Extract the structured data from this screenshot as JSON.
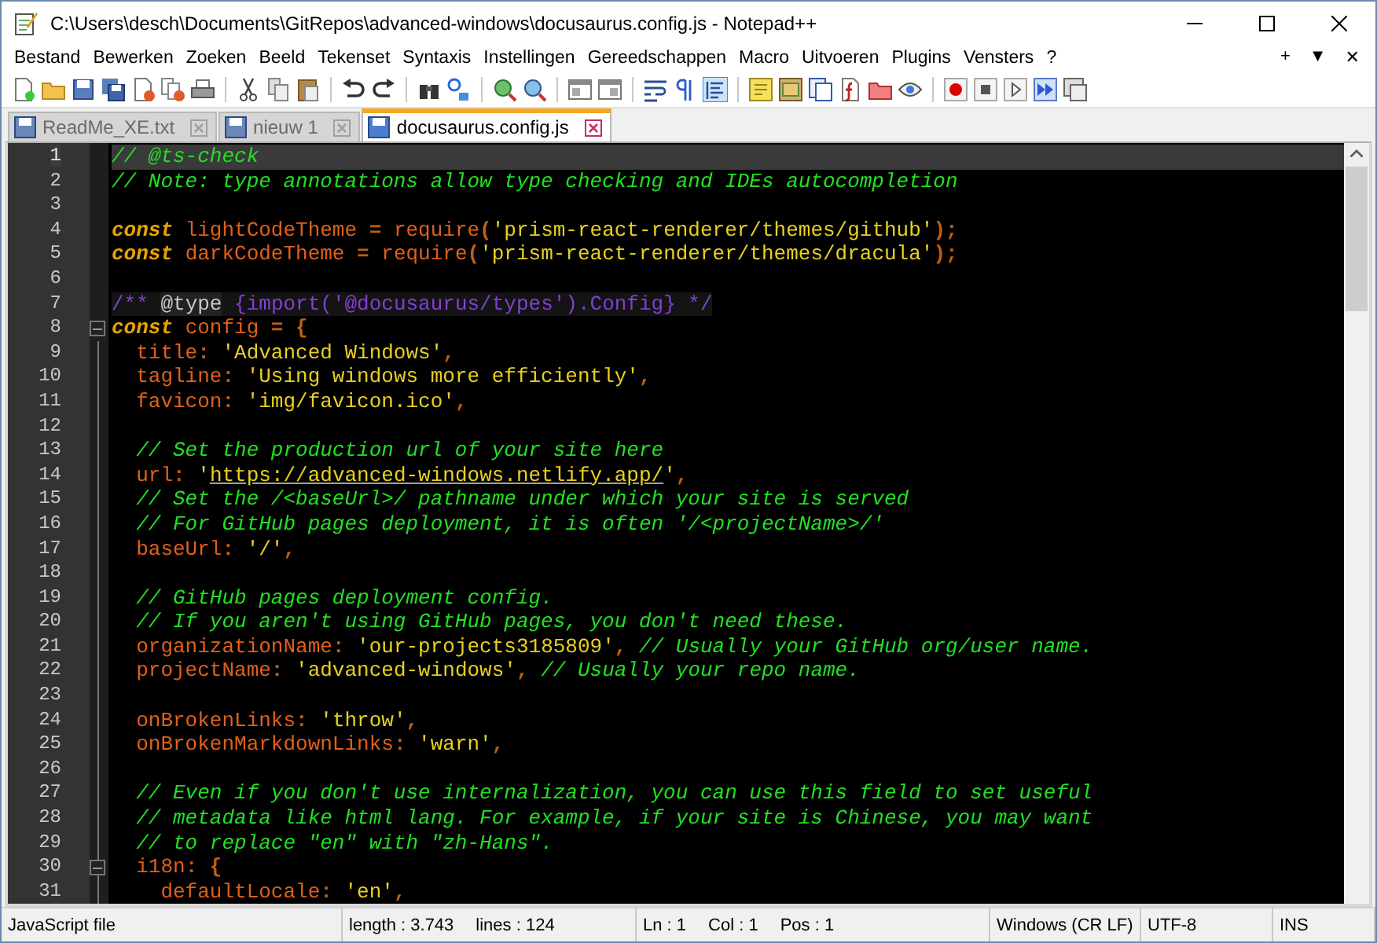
{
  "window": {
    "title": "C:\\Users\\desch\\Documents\\GitRepos\\advanced-windows\\docusaurus.config.js - Notepad++"
  },
  "menu": [
    "Bestand",
    "Bewerken",
    "Zoeken",
    "Beeld",
    "Tekenset",
    "Syntaxis",
    "Instellingen",
    "Gereedschappen",
    "Macro",
    "Uitvoeren",
    "Plugins",
    "Vensters",
    "?"
  ],
  "menu_right": [
    "+",
    "▼",
    "✕"
  ],
  "tabs": [
    {
      "label": "ReadMe_XE.txt",
      "selected": false
    },
    {
      "label": "nieuw 1",
      "selected": false
    },
    {
      "label": "docusaurus.config.js",
      "selected": true
    }
  ],
  "lines": [
    {
      "number": "1",
      "current": true,
      "fold": false,
      "tokens": [
        {
          "kind": "comment",
          "text": "// @ts-check"
        }
      ]
    },
    {
      "number": "2",
      "current": false,
      "fold": false,
      "tokens": [
        {
          "kind": "comment",
          "text": "// Note: type annotations allow type checking and IDEs autocompletion"
        }
      ]
    },
    {
      "number": "3",
      "current": false,
      "fold": false
    },
    {
      "number": "4",
      "current": false,
      "fold": false,
      "tokens": [
        {
          "kind": "keyword",
          "text": "const "
        },
        {
          "kind": "ident",
          "text": "lightCodeTheme"
        },
        {
          "kind": "op",
          "text": " = "
        },
        {
          "kind": "ident",
          "text": "require"
        },
        {
          "kind": "op",
          "text": "("
        },
        {
          "kind": "string",
          "text": "'prism-react-renderer/themes/github'"
        },
        {
          "kind": "op",
          "text": ");"
        }
      ]
    },
    {
      "number": "5",
      "current": false,
      "fold": false,
      "tokens": [
        {
          "kind": "keyword",
          "text": "const "
        },
        {
          "kind": "ident",
          "text": "darkCodeTheme"
        },
        {
          "kind": "op",
          "text": " = "
        },
        {
          "kind": "ident",
          "text": "require"
        },
        {
          "kind": "op",
          "text": "("
        },
        {
          "kind": "string",
          "text": "'prism-react-renderer/themes/dracula'"
        },
        {
          "kind": "op",
          "text": ");"
        }
      ]
    },
    {
      "number": "6",
      "current": false,
      "fold": false
    },
    {
      "number": "7",
      "current": false,
      "fold": false,
      "tokens": [
        {
          "kind": "doc",
          "text": "/** "
        },
        {
          "kind": "doctag",
          "text": "@type"
        },
        {
          "kind": "doc",
          "text": " {import('@docusaurus/types').Config} */"
        }
      ]
    },
    {
      "number": "8",
      "current": false,
      "fold": true,
      "tokens": [
        {
          "kind": "keyword",
          "text": "const "
        },
        {
          "kind": "ident",
          "text": "config"
        },
        {
          "kind": "op",
          "text": " = {"
        }
      ]
    },
    {
      "number": "9",
      "current": false,
      "fold": false,
      "tokens": [
        {
          "kind": "ident",
          "text": "  title"
        },
        {
          "kind": "op",
          "text": ": "
        },
        {
          "kind": "string",
          "text": "'Advanced Windows'"
        },
        {
          "kind": "op",
          "text": ","
        }
      ]
    },
    {
      "number": "10",
      "current": false,
      "fold": false,
      "tokens": [
        {
          "kind": "ident",
          "text": "  tagline"
        },
        {
          "kind": "op",
          "text": ": "
        },
        {
          "kind": "string",
          "text": "'Using windows more efficiently'"
        },
        {
          "kind": "op",
          "text": ","
        }
      ]
    },
    {
      "number": "11",
      "current": false,
      "fold": false,
      "tokens": [
        {
          "kind": "ident",
          "text": "  favicon"
        },
        {
          "kind": "op",
          "text": ": "
        },
        {
          "kind": "string",
          "text": "'img/favicon.ico'"
        },
        {
          "kind": "op",
          "text": ","
        }
      ]
    },
    {
      "number": "12",
      "current": false,
      "fold": false
    },
    {
      "number": "13",
      "current": false,
      "fold": false,
      "tokens": [
        {
          "kind": "comment",
          "text": "  // Set the production url of your site here"
        }
      ]
    },
    {
      "number": "14",
      "current": false,
      "fold": false,
      "tokens": [
        {
          "kind": "ident",
          "text": "  url"
        },
        {
          "kind": "op",
          "text": ": "
        },
        {
          "kind": "string",
          "text": "'"
        },
        {
          "kind": "link",
          "text": "https://advanced-windows.netlify.app/"
        },
        {
          "kind": "string",
          "text": "'"
        },
        {
          "kind": "op",
          "text": ","
        }
      ]
    },
    {
      "number": "15",
      "current": false,
      "fold": false,
      "tokens": [
        {
          "kind": "comment",
          "text": "  // Set the /<baseUrl>/ pathname under which your site is served"
        }
      ]
    },
    {
      "number": "16",
      "current": false,
      "fold": false,
      "tokens": [
        {
          "kind": "comment",
          "text": "  // For GitHub pages deployment, it is often '/<projectName>/'"
        }
      ]
    },
    {
      "number": "17",
      "current": false,
      "fold": false,
      "tokens": [
        {
          "kind": "ident",
          "text": "  baseUrl"
        },
        {
          "kind": "op",
          "text": ": "
        },
        {
          "kind": "string",
          "text": "'/'"
        },
        {
          "kind": "op",
          "text": ","
        }
      ]
    },
    {
      "number": "18",
      "current": false,
      "fold": false
    },
    {
      "number": "19",
      "current": false,
      "fold": false,
      "tokens": [
        {
          "kind": "comment",
          "text": "  // GitHub pages deployment config."
        }
      ]
    },
    {
      "number": "20",
      "current": false,
      "fold": false,
      "tokens": [
        {
          "kind": "comment",
          "text": "  // If you aren't using GitHub pages, you don't need these."
        }
      ]
    },
    {
      "number": "21",
      "current": false,
      "fold": false,
      "tokens": [
        {
          "kind": "ident",
          "text": "  organizationName"
        },
        {
          "kind": "op",
          "text": ": "
        },
        {
          "kind": "string",
          "text": "'our-projects3185809'"
        },
        {
          "kind": "op",
          "text": ", "
        },
        {
          "kind": "comment",
          "text": "// Usually your GitHub org/user name."
        }
      ]
    },
    {
      "number": "22",
      "current": false,
      "fold": false,
      "tokens": [
        {
          "kind": "ident",
          "text": "  projectName"
        },
        {
          "kind": "op",
          "text": ": "
        },
        {
          "kind": "string",
          "text": "'advanced-windows'"
        },
        {
          "kind": "op",
          "text": ", "
        },
        {
          "kind": "comment",
          "text": "// Usually your repo name."
        }
      ]
    },
    {
      "number": "23",
      "current": false,
      "fold": false
    },
    {
      "number": "24",
      "current": false,
      "fold": false,
      "tokens": [
        {
          "kind": "ident",
          "text": "  onBrokenLinks"
        },
        {
          "kind": "op",
          "text": ": "
        },
        {
          "kind": "string",
          "text": "'throw'"
        },
        {
          "kind": "op",
          "text": ","
        }
      ]
    },
    {
      "number": "25",
      "current": false,
      "fold": false,
      "tokens": [
        {
          "kind": "ident",
          "text": "  onBrokenMarkdownLinks"
        },
        {
          "kind": "op",
          "text": ": "
        },
        {
          "kind": "string",
          "text": "'warn'"
        },
        {
          "kind": "op",
          "text": ","
        }
      ]
    },
    {
      "number": "26",
      "current": false,
      "fold": false
    },
    {
      "number": "27",
      "current": false,
      "fold": false,
      "tokens": [
        {
          "kind": "comment",
          "text": "  // Even if you don't use internalization, you can use this field to set useful"
        }
      ]
    },
    {
      "number": "28",
      "current": false,
      "fold": false,
      "tokens": [
        {
          "kind": "comment",
          "text": "  // metadata like html lang. For example, if your site is Chinese, you may want"
        }
      ]
    },
    {
      "number": "29",
      "current": false,
      "fold": false,
      "tokens": [
        {
          "kind": "comment",
          "text": "  // to replace \"en\" with \"zh-Hans\"."
        }
      ]
    },
    {
      "number": "30",
      "current": false,
      "fold": true,
      "tokens": [
        {
          "kind": "ident",
          "text": "  i18n"
        },
        {
          "kind": "op",
          "text": ": {"
        }
      ]
    },
    {
      "number": "31",
      "current": false,
      "fold": false,
      "tokens": [
        {
          "kind": "ident",
          "text": "    defaultLocale"
        },
        {
          "kind": "op",
          "text": ": "
        },
        {
          "kind": "string",
          "text": "'en'"
        },
        {
          "kind": "op",
          "text": ","
        }
      ]
    }
  ],
  "status_bar": [
    [
      "JavaScript file"
    ],
    [
      "length : 3.743",
      "lines : 124"
    ],
    [
      "Ln : 1",
      "Col : 1",
      "Pos : 1"
    ],
    [
      "Windows (CR LF)"
    ],
    [
      "UTF-8"
    ],
    [
      "INS"
    ]
  ]
}
